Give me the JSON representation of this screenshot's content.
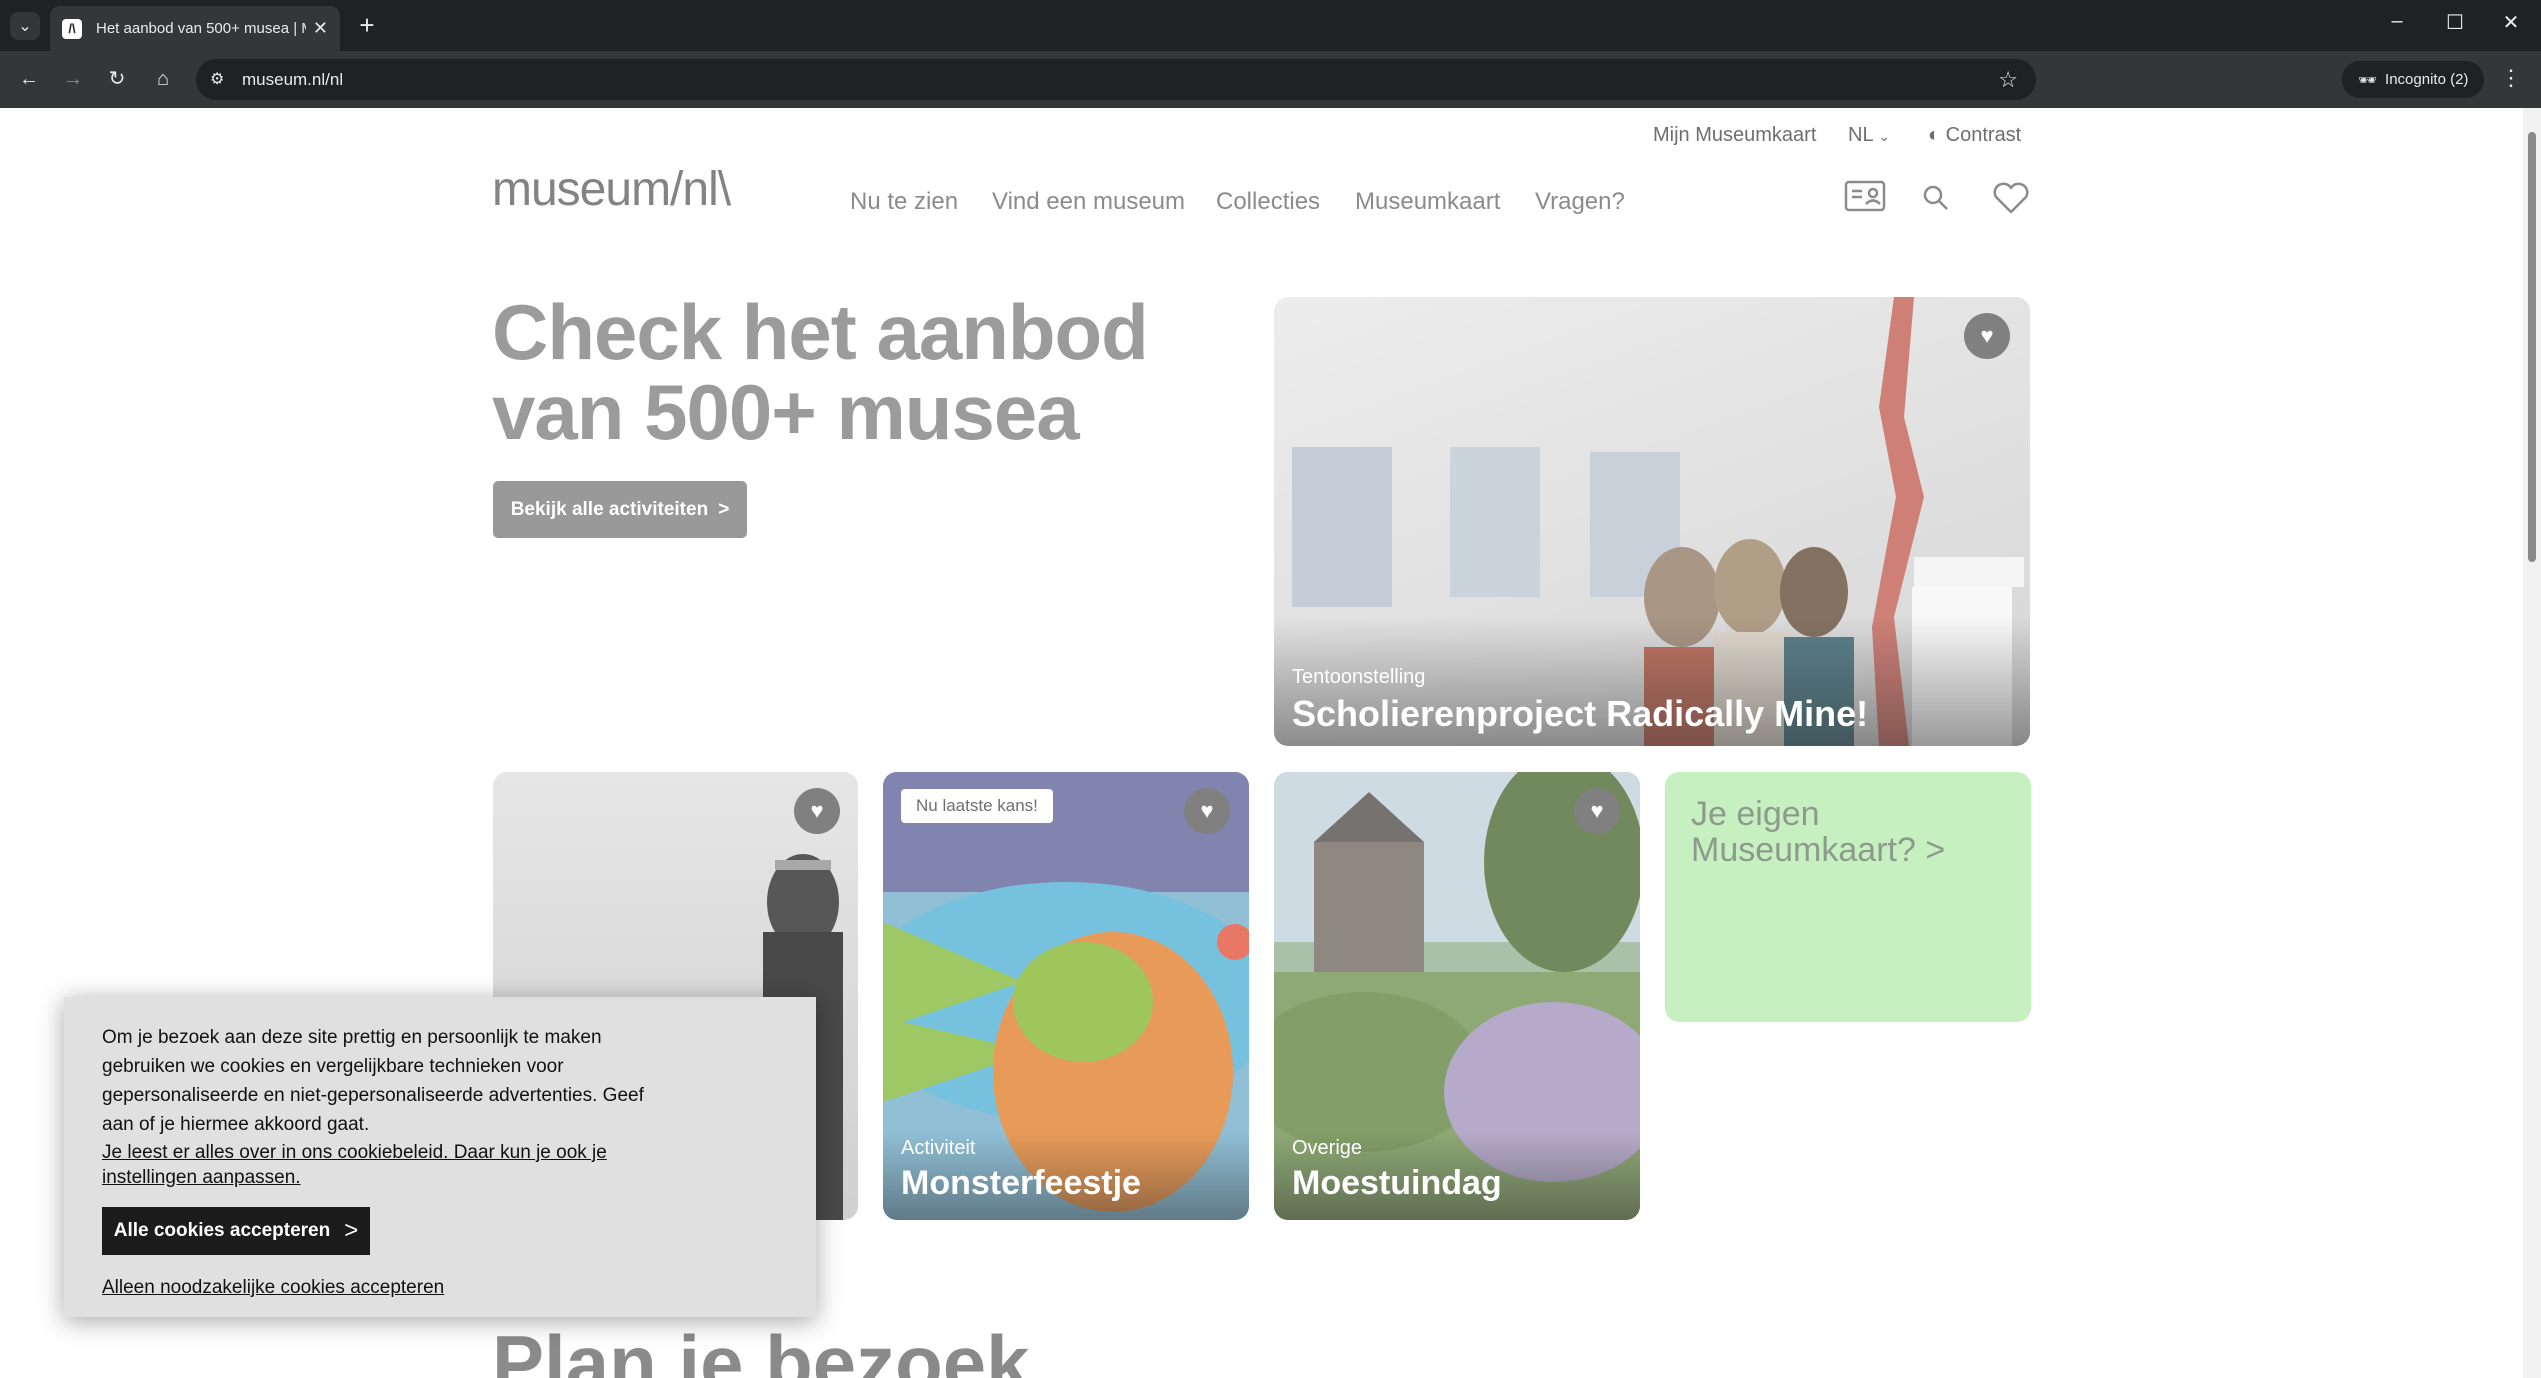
{
  "browser": {
    "tab_title": "Het aanbod van 500+ musea | M",
    "url": "museum.nl/nl",
    "incognito_label": "Incognito (2)"
  },
  "utility_nav": {
    "mijn_museumkaart": "Mijn Museumkaart",
    "language": "NL",
    "contrast": "Contrast"
  },
  "header": {
    "logo": "museum/nl\\",
    "nav": [
      "Nu te zien",
      "Vind een museum",
      "Collecties",
      "Museumkaart",
      "Vragen?"
    ]
  },
  "hero": {
    "title_line1": "Check het aanbod",
    "title_line2": "van 500+ musea",
    "button_label": "Bekijk alle activiteiten"
  },
  "cards": {
    "featured": {
      "type": "Tentoonstelling",
      "title": "Scholierenproject Radically Mine!"
    },
    "card2": {
      "badge": "Nu laatste kans!",
      "type": "Activiteit",
      "title": "Monsterfeestje"
    },
    "card3": {
      "type": "Overige",
      "title": "Moestuindag"
    },
    "promo": {
      "title_line1": "Je eigen",
      "title_line2": "Museumkaart? >"
    }
  },
  "cookie_banner": {
    "text": "Om je bezoek aan deze site prettig en persoonlijk te maken gebruiken we cookies en vergelijkbare technieken voor gepersonaliseerde en niet-gepersonaliseerde advertenties. Geef aan of je hiermee akkoord gaat.",
    "policy_link": "Je leest er alles over in ons cookiebeleid. Daar kun je ook je instellingen aanpassen.",
    "accept_all": "Alle cookies accepteren",
    "necessary_only": "Alleen noodzakelijke cookies accepteren"
  },
  "section_heading": "Plan je bezoek",
  "colors": {
    "promo_green": "#bdeeb5",
    "accept_button": "#1c1c1c"
  }
}
